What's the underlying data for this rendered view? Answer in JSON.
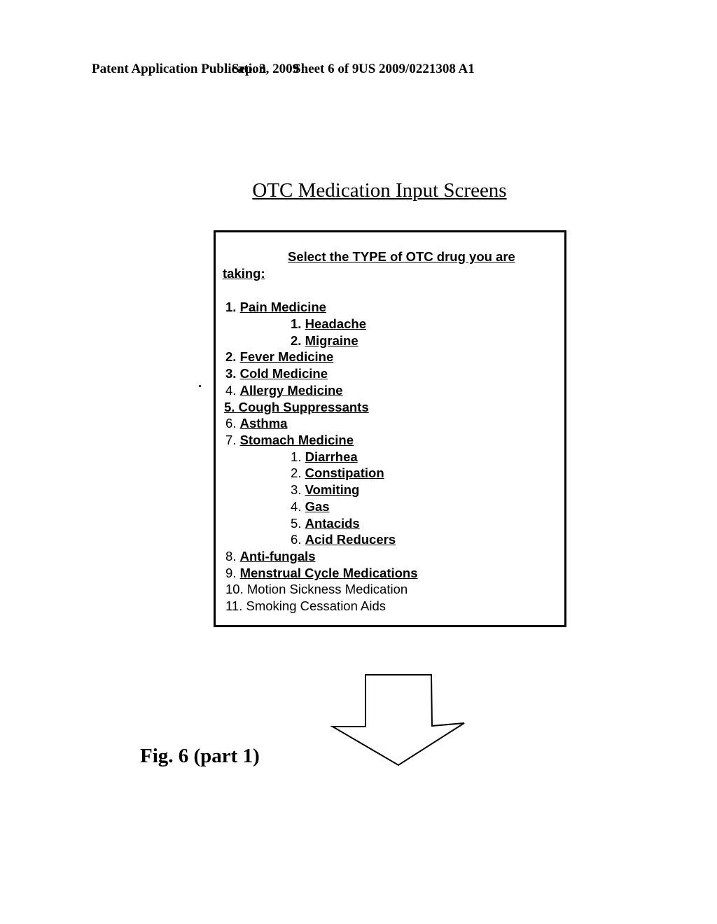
{
  "header": {
    "publication": "Patent Application Publication",
    "date": "Sep. 3, 2009",
    "sheet": "Sheet 6 of 9",
    "number": "US 2009/0221308 A1"
  },
  "title": "OTC Medication Input Screens",
  "screen": {
    "prompt_line1": "Select the TYPE of OTC drug you are",
    "prompt_line2": "taking:",
    "items": [
      {
        "num": "1.",
        "label": "Pain Medicine"
      },
      {
        "num": "1.",
        "label": "Headache"
      },
      {
        "num": "2.",
        "label": "Migraine"
      },
      {
        "num": "2.",
        "label": "Fever Medicine"
      },
      {
        "num": "3.",
        "label": "Cold Medicine"
      },
      {
        "num": "4.",
        "label": "Allergy Medicine"
      },
      {
        "num": "5.",
        "label": "Cough Suppressants"
      },
      {
        "num": "6.",
        "label": "Asthma"
      },
      {
        "num": "7.",
        "label": "Stomach Medicine"
      },
      {
        "num": "1.",
        "label": "Diarrhea"
      },
      {
        "num": "2.",
        "label": "Constipation"
      },
      {
        "num": "3.",
        "label": "Vomiting"
      },
      {
        "num": "4.",
        "label": "Gas"
      },
      {
        "num": "5.",
        "label": "Antacids"
      },
      {
        "num": "6.",
        "label": "Acid Reducers"
      },
      {
        "num": "8.",
        "label": "Anti-fungals"
      },
      {
        "num": "9.",
        "label": "Menstrual Cycle Medications"
      },
      {
        "num": "10.",
        "label": "Motion Sickness Medication"
      },
      {
        "num": "11.",
        "label": "Smoking Cessation Aids"
      }
    ]
  },
  "figure_label": "Fig. 6 (part 1)",
  "arrow_icon": "down-arrow-icon"
}
